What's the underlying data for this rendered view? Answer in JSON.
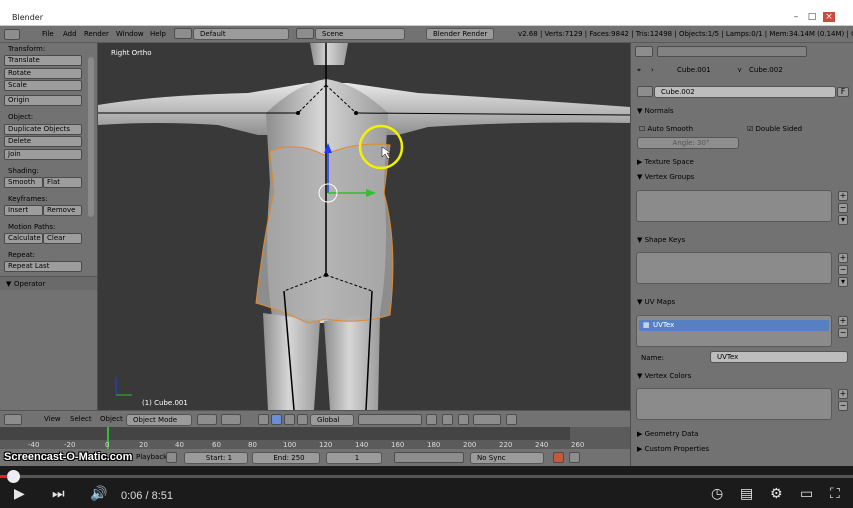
{
  "window": {
    "title": "Blender"
  },
  "info_header": {
    "menus": [
      "File",
      "Add",
      "Render",
      "Window",
      "Help"
    ],
    "layout": "Default",
    "scene": "Scene",
    "engine": "Blender Render",
    "stats": "v2.68 | Verts:7129 | Faces:9842 | Tris:12498 | Objects:1/5 | Lamps:0/1 | Mem:34.14M (0.14M) | Cube.00"
  },
  "tool_shelf": {
    "transform_label": "Transform:",
    "translate": "Translate",
    "rotate": "Rotate",
    "scale": "Scale",
    "origin": "Origin",
    "object_label": "Object:",
    "duplicate": "Duplicate Objects",
    "delete": "Delete",
    "join": "Join",
    "shading_label": "Shading:",
    "smooth": "Smooth",
    "flat": "Flat",
    "keyframes_label": "Keyframes:",
    "insert": "Insert",
    "remove": "Remove",
    "motion_label": "Motion Paths:",
    "calculate": "Calculate",
    "clear": "Clear",
    "repeat_label": "Repeat:",
    "repeat_last": "Repeat Last",
    "operator": "Operator"
  },
  "viewport": {
    "view_label": "Right Ortho",
    "object_label": "(1) Cube.001"
  },
  "view3d_header": {
    "menus": [
      "View",
      "Select",
      "Object"
    ],
    "mode": "Object Mode",
    "orientation": "Global"
  },
  "timeline": {
    "ticks": [
      "-40",
      "-20",
      "0",
      "20",
      "40",
      "60",
      "80",
      "100",
      "120",
      "140",
      "160",
      "180",
      "200",
      "220",
      "240",
      "260"
    ],
    "playback": "Playback",
    "start": "Start: 1",
    "end": "End: 250",
    "current": "1",
    "sync": "No Sync"
  },
  "properties": {
    "breadcrumb_a": "Cube.001",
    "breadcrumb_b": "Cube.002",
    "mesh_name": "Cube.002",
    "fake_user": "F",
    "normals": "Normals",
    "auto_smooth": "Auto Smooth",
    "double_sided": "Double Sided",
    "angle": "Angle: 30°",
    "texture_space": "Texture Space",
    "vertex_groups": "Vertex Groups",
    "shape_keys": "Shape Keys",
    "uv_maps": "UV Maps",
    "uv_item": "UVTex",
    "name_label": "Name:",
    "name_value": "UVTex",
    "vertex_colors": "Vertex Colors",
    "geometry_data": "Geometry Data",
    "custom_properties": "Custom Properties"
  },
  "watermark": "Screencast-O-Matic.com",
  "player": {
    "time": "0:06 / 8:51",
    "progress": 0.011
  }
}
